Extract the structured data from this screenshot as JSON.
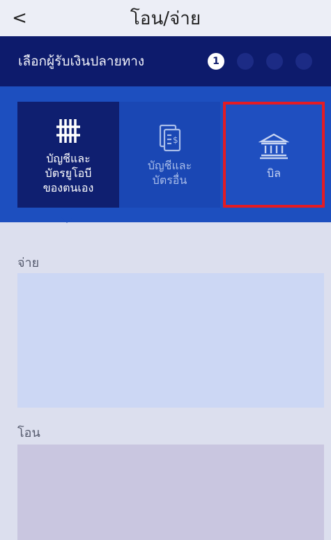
{
  "header": {
    "back_glyph": "<",
    "title": "โอน/จ่าย"
  },
  "stepper": {
    "label": "เลือกผู้รับเงินปลายทาง",
    "steps": [
      "1",
      "",
      "",
      ""
    ],
    "active_step": 1
  },
  "options": [
    {
      "label": "บัญชีและบัตรยูโอบีของตนเอง",
      "icon": "hash-icon",
      "state": "selected"
    },
    {
      "label": "บัญชีและบัตรอื่น",
      "icon": "document-dollar-icon",
      "state": "default"
    },
    {
      "label": "บิล",
      "icon": "bank-icon",
      "state": "highlighted"
    }
  ],
  "colors": {
    "header_navy": "#0d1b6c",
    "option_blue": "#1d4fbf",
    "highlight_red": "#e41b23"
  },
  "sections": {
    "pay_label": "จ่าย",
    "transfer_label": "โอน"
  }
}
